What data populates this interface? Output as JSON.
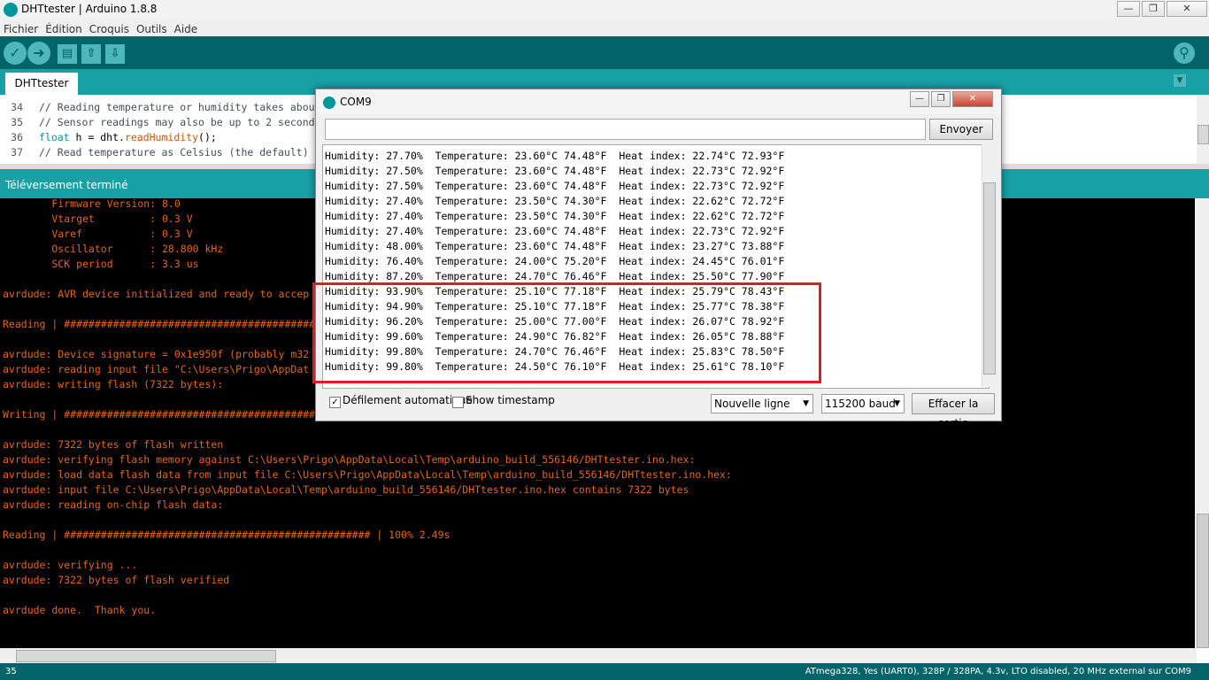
{
  "window": {
    "title": "DHTtester | Arduino 1.8.8"
  },
  "menu": [
    "Fichier",
    "Édition",
    "Croquis",
    "Outils",
    "Aide"
  ],
  "tab": {
    "label": "DHTtester"
  },
  "editor": {
    "lines": [
      {
        "num": "34",
        "code": "// Reading temperature or humidity takes abou"
      },
      {
        "num": "35",
        "code": "// Sensor readings may also be up to 2 second"
      },
      {
        "num": "36",
        "kw": "float",
        "mid": " h = dht.",
        "fn": "readHumidity",
        "tail": "();"
      },
      {
        "num": "37",
        "code": "// Read temperature as Celsius (the default)"
      }
    ]
  },
  "status": {
    "message": "Téléversement terminé"
  },
  "console": {
    "lines": [
      "        Firmware Version: 8.0",
      "        Vtarget         : 0.3 V",
      "        Varef           : 0.3 V",
      "        Oscillator      : 28.800 kHz",
      "        SCK period      : 3.3 us",
      "",
      "avrdude: AVR device initialized and ready to accep",
      "",
      "Reading | ##########################################",
      "",
      "avrdude: Device signature = 0x1e950f (probably m32",
      "avrdude: reading input file \"C:\\Users\\Prigo\\AppDat",
      "avrdude: writing flash (7322 bytes):",
      "",
      "Writing | ##########################################",
      "",
      "avrdude: 7322 bytes of flash written",
      "avrdude: verifying flash memory against C:\\Users\\Prigo\\AppData\\Local\\Temp\\arduino_build_556146/DHTtester.ino.hex:",
      "avrdude: load data flash data from input file C:\\Users\\Prigo\\AppData\\Local\\Temp\\arduino_build_556146/DHTtester.ino.hex:",
      "avrdude: input file C:\\Users\\Prigo\\AppData\\Local\\Temp\\arduino_build_556146/DHTtester.ino.hex contains 7322 bytes",
      "avrdude: reading on-chip flash data:",
      "",
      "Reading | ################################################## | 100% 2.49s",
      "",
      "avrdude: verifying ...",
      "avrdude: 7322 bytes of flash verified",
      "",
      "avrdude done.  Thank you."
    ]
  },
  "footer": {
    "line_number": "35",
    "board": "ATmega328, Yes (UART0), 328P / 328PA, 4.3v, LTO disabled, 20 MHz external sur COM9"
  },
  "serial": {
    "title": "COM9",
    "send_label": "Envoyer",
    "input_value": "",
    "lines": [
      "Humidity: 27.70%  Temperature: 23.60°C 74.48°F  Heat index: 22.74°C 72.93°F",
      "Humidity: 27.50%  Temperature: 23.60°C 74.48°F  Heat index: 22.73°C 72.92°F",
      "Humidity: 27.50%  Temperature: 23.60°C 74.48°F  Heat index: 22.73°C 72.92°F",
      "Humidity: 27.40%  Temperature: 23.50°C 74.30°F  Heat index: 22.62°C 72.72°F",
      "Humidity: 27.40%  Temperature: 23.50°C 74.30°F  Heat index: 22.62°C 72.72°F",
      "Humidity: 27.40%  Temperature: 23.60°C 74.48°F  Heat index: 22.73°C 72.92°F",
      "Humidity: 48.00%  Temperature: 23.60°C 74.48°F  Heat index: 23.27°C 73.88°F",
      "Humidity: 76.40%  Temperature: 24.00°C 75.20°F  Heat index: 24.45°C 76.01°F",
      "Humidity: 87.20%  Temperature: 24.70°C 76.46°F  Heat index: 25.50°C 77.90°F",
      "Humidity: 93.90%  Temperature: 25.10°C 77.18°F  Heat index: 25.79°C 78.43°F",
      "Humidity: 94.90%  Temperature: 25.10°C 77.18°F  Heat index: 25.77°C 78.38°F",
      "Humidity: 96.20%  Temperature: 25.00°C 77.00°F  Heat index: 26.07°C 78.92°F",
      "Humidity: 99.60%  Temperature: 24.90°C 76.82°F  Heat index: 26.05°C 78.88°F",
      "Humidity: 99.80%  Temperature: 24.70°C 76.46°F  Heat index: 25.83°C 78.50°F",
      "Humidity: 99.80%  Temperature: 24.50°C 76.10°F  Heat index: 25.61°C 78.10°F"
    ],
    "autoscroll_label": "Défilement automatique",
    "autoscroll_checked": true,
    "timestamp_label": "Show timestamp",
    "timestamp_checked": false,
    "line_ending": "Nouvelle ligne",
    "baud": "115200 baud",
    "clear_label": "Effacer la sortie"
  },
  "colors": {
    "toolbar": "#006468",
    "tabbar": "#17a1a5",
    "console_text": "#e3651d",
    "highlight": "#e11b22"
  }
}
